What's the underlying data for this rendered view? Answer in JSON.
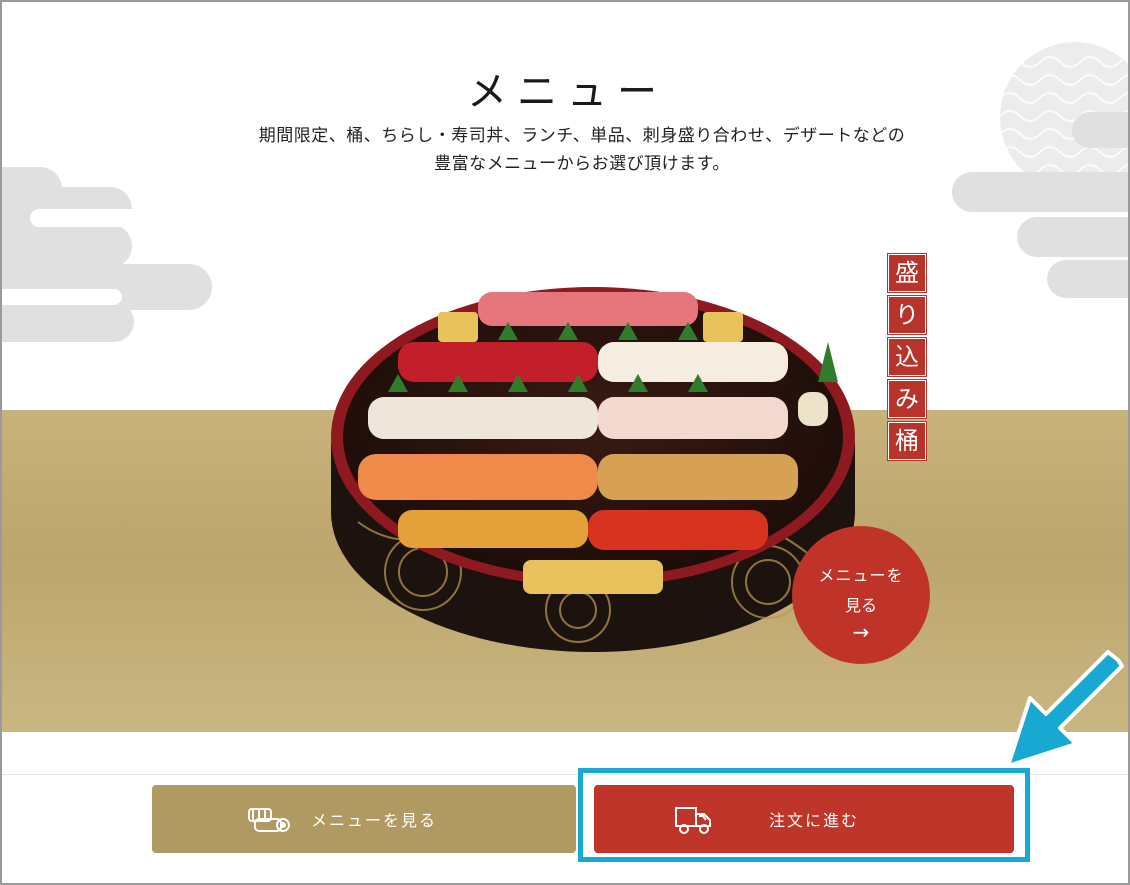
{
  "page": {
    "title": "メニュー",
    "lead_line1": "期間限定、桶、ちらし・寿司丼、ランチ、単品、刺身盛り合わせ、デザートなどの",
    "lead_line2": "豊富なメニューからお選び頂けます。"
  },
  "feature": {
    "vertical_label": [
      "盛",
      "り",
      "込",
      "み",
      "桶"
    ],
    "menu_circle": {
      "line1": "メニューを",
      "line2": "見る",
      "arrow": "→"
    }
  },
  "bottom_bar": {
    "menu_button": {
      "label": "メニューを見る",
      "icon": "sushi-icon"
    },
    "order_button": {
      "label": "注文に進む",
      "icon": "delivery-truck-icon"
    }
  },
  "colors": {
    "accent_red": "#c0352a",
    "gold": "#b09a62",
    "highlight_blue": "#18a9d3"
  }
}
